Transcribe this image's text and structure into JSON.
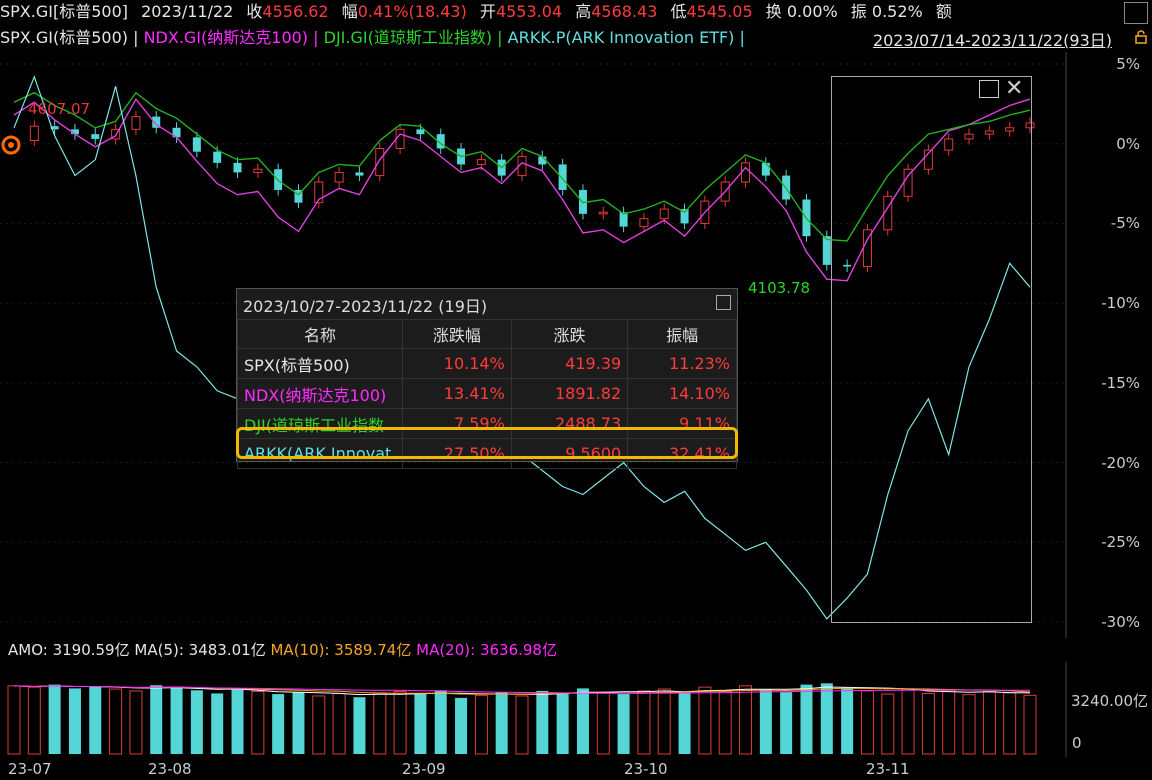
{
  "topbar": {
    "code": "SPX.GI[标普500]",
    "date": "2023/11/22",
    "close_label": "收",
    "close_value": "4556.62",
    "chg_label": "幅",
    "chg_value": "0.41%(18.43)",
    "open_label": "开",
    "open_value": "4553.04",
    "high_label": "高",
    "high_value": "4568.43",
    "low_label": "低",
    "low_value": "4545.05",
    "turnover_label": "换",
    "turnover_value": "0.00%",
    "amp_label": "振",
    "amp_value": "0.52%",
    "amount_label": "额"
  },
  "legendbar": {
    "s1": "SPX.GI(标普500) |",
    "s2": " NDX.GI(纳斯达克100) |",
    "s3": " DJI.GI(道琼斯工业指数) |",
    "s4": " ARKK.P(ARK Innovation ETF) |",
    "range": "2023/07/14-2023/11/22(93日)"
  },
  "annotations": {
    "high": "4607.07",
    "low": "4103.78"
  },
  "yaxis": [
    "5%",
    "0%",
    "-5%",
    "-10%",
    "-15%",
    "-20%",
    "-25%",
    "-30%"
  ],
  "xaxis": [
    "23-07",
    "23-08",
    "23-09",
    "23-10",
    "23-11"
  ],
  "volume_axis": {
    "mid": "3240.00亿",
    "zero": "0"
  },
  "amo": {
    "label": "AMO: 3190.59亿",
    "ma5": "MA(5): 3483.01亿",
    "ma10": "MA(10): 3589.74亿",
    "ma20": "MA(20): 3636.98亿"
  },
  "popup": {
    "title": "2023/10/27-2023/11/22 (19日)",
    "headers": [
      "名称",
      "涨跌幅",
      "涨跌",
      "振幅"
    ],
    "rows": [
      {
        "name": "SPX(标普500)",
        "pct": "10.14%",
        "chg": "419.39",
        "amp": "11.23%"
      },
      {
        "name": "NDX(纳斯达克100)",
        "pct": "13.41%",
        "chg": "1891.82",
        "amp": "14.10%"
      },
      {
        "name": "DJI(道琼斯工业指数",
        "pct": "7.59%",
        "chg": "2488.73",
        "amp": "9.11%"
      },
      {
        "name": "ARKK(ARK Innovat",
        "pct": "27.50%",
        "chg": "9.5600",
        "amp": "32.41%"
      }
    ]
  },
  "colors": {
    "up": "#e33a3a",
    "down": "#54d6d6",
    "ndx": "#e040e0",
    "dji": "#22b022",
    "arkk": "#7fe6e6",
    "highlight": "#f2b800"
  },
  "chart_data": {
    "type": "line",
    "ylim": [
      -30,
      5
    ],
    "series": [
      {
        "name": "NDX.GI(纳斯达克100)",
        "values": [
          1.8,
          2.6,
          1.5,
          0.6,
          -0.2,
          0.5,
          2.8,
          1.2,
          0.4,
          -1.1,
          -2.5,
          -3.2,
          -3.0,
          -4.6,
          -5.5,
          -3.5,
          -2.8,
          -3.2,
          -1.0,
          0.6,
          0.2,
          -0.8,
          -1.8,
          -1.5,
          -2.5,
          -1.2,
          -1.7,
          -3.5,
          -5.6,
          -5.4,
          -6.2,
          -5.5,
          -4.8,
          -5.8,
          -4.3,
          -3.0,
          -1.5,
          -2.7,
          -4.2,
          -6.8,
          -8.5,
          -8.6,
          -6.0,
          -4.0,
          -2.0,
          -0.6,
          0.8,
          1.2,
          1.8,
          2.4,
          2.8
        ]
      },
      {
        "name": "DJI.GI(道琼斯工业指数)",
        "values": [
          2.6,
          3.2,
          2.4,
          1.8,
          1.0,
          1.4,
          3.2,
          2.2,
          1.6,
          0.6,
          -0.4,
          -1.0,
          -0.9,
          -2.3,
          -3.2,
          -1.8,
          -1.3,
          -1.4,
          0.2,
          1.2,
          1.1,
          0.0,
          -0.8,
          -0.5,
          -1.5,
          -0.3,
          -0.8,
          -2.2,
          -3.7,
          -3.5,
          -4.4,
          -4.1,
          -3.6,
          -4.3,
          -2.9,
          -1.8,
          -0.7,
          -1.2,
          -2.8,
          -4.7,
          -6.0,
          -6.1,
          -4.0,
          -2.0,
          -0.6,
          0.6,
          0.9,
          1.2,
          1.4,
          1.8,
          2.1
        ]
      },
      {
        "name": "ARKK.P(ARK Innovation ETF)",
        "values": [
          1.0,
          4.2,
          0.5,
          -2.0,
          -1.0,
          3.6,
          -2.0,
          -9.0,
          -13.0,
          -14.0,
          -15.5,
          -16.0,
          -14.0,
          -11.0,
          -14.5,
          -16.0,
          -17.0,
          -18.5,
          -19.0,
          -18.2,
          -17.0,
          -19.5,
          -18.5,
          -18.0,
          -19.0,
          -19.5,
          -20.5,
          -21.5,
          -22.0,
          -21.0,
          -20.0,
          -21.5,
          -22.5,
          -21.8,
          -23.5,
          -24.5,
          -25.5,
          -25.0,
          -26.5,
          -28.0,
          -29.8,
          -28.5,
          -27.0,
          -22.0,
          -18.0,
          -16.0,
          -19.5,
          -14.0,
          -11.0,
          -7.5,
          -9.0
        ]
      },
      {
        "name": "SPX.GI(标普500)",
        "values": [
          0.2,
          1.1,
          0.9,
          0.6,
          0.3,
          0.9,
          1.7,
          1.0,
          0.4,
          -0.5,
          -1.2,
          -1.8,
          -1.6,
          -2.9,
          -3.7,
          -2.4,
          -1.8,
          -2.0,
          -0.3,
          0.9,
          0.6,
          -0.3,
          -1.3,
          -1.0,
          -2.0,
          -0.8,
          -1.3,
          -2.9,
          -4.4,
          -4.3,
          -5.2,
          -4.7,
          -4.1,
          -5.0,
          -3.6,
          -2.4,
          -1.2,
          -2.0,
          -3.5,
          -5.8,
          -7.6,
          -7.7,
          -5.4,
          -3.3,
          -1.6,
          -0.4,
          0.3,
          0.6,
          0.8,
          1.0,
          1.3
        ]
      }
    ],
    "volume": [
      108,
      106,
      110,
      104,
      107,
      103,
      100,
      109,
      107,
      101,
      96,
      102,
      99,
      95,
      98,
      92,
      96,
      90,
      97,
      99,
      95,
      101,
      89,
      93,
      98,
      92,
      100,
      96,
      104,
      98,
      95,
      100,
      103,
      97,
      106,
      99,
      108,
      103,
      98,
      110,
      112,
      105,
      100,
      95,
      103,
      96,
      101,
      94,
      99,
      97,
      93
    ]
  }
}
